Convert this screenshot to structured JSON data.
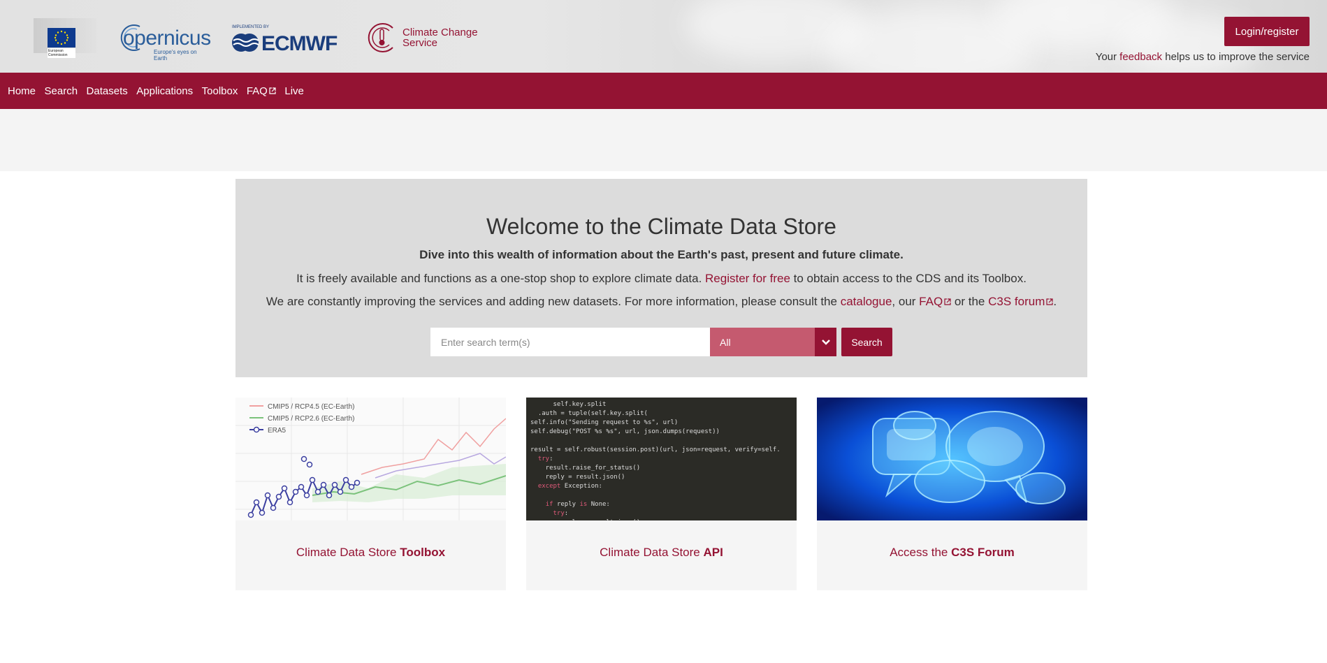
{
  "header": {
    "logos": {
      "ec_text": "European Commission",
      "copernicus_word": "opernicus",
      "copernicus_tagline": "Europe's eyes on Earth",
      "ecmwf_small": "IMPLEMENTED BY",
      "ecmwf_word": "ECMWF",
      "c3s_line1": "Climate Change",
      "c3s_line2": "Service"
    },
    "login_label": "Login/register",
    "feedback_prefix": "Your ",
    "feedback_link": "feedback",
    "feedback_suffix": " helps us to improve the service"
  },
  "nav": {
    "items": [
      {
        "label": "Home",
        "icon": ""
      },
      {
        "label": "Search",
        "icon": ""
      },
      {
        "label": "Datasets",
        "icon": ""
      },
      {
        "label": "Applications",
        "icon": ""
      },
      {
        "label": "Toolbox",
        "icon": ""
      },
      {
        "label": "FAQ",
        "icon": "external-link-icon"
      },
      {
        "label": "Live",
        "icon": ""
      }
    ]
  },
  "hero": {
    "title": "Welcome to the Climate Data Store",
    "lead": "Dive into this wealth of information about the Earth's past, present and future climate.",
    "p1_before": "It is freely available and functions as a one-stop shop to explore climate data. ",
    "p1_link": "Register for free",
    "p1_after": " to obtain access to the CDS and its Toolbox.",
    "p2_before": "We are constantly improving the services and adding new datasets. For more information, please consult the ",
    "p2_link1": "catalogue",
    "p2_mid1": ", our ",
    "p2_link2": "FAQ",
    "p2_mid2": " or the ",
    "p2_link3": "C3S forum",
    "p2_end": "."
  },
  "search": {
    "placeholder": "Enter search term(s)",
    "value": "",
    "select_value": "All",
    "button_label": "Search"
  },
  "cards": [
    {
      "title_prefix": "Climate Data Store ",
      "title_bold": "Toolbox",
      "legend": [
        "CMIP5 / RCP4.5 (EC-Earth)",
        "CMIP5 / RCP2.6 (EC-Earth)",
        "ERA5"
      ]
    },
    {
      "title_prefix": "Climate Data Store ",
      "title_bold": "API"
    },
    {
      "title_prefix": "Access the ",
      "title_bold": "C3S Forum"
    }
  ],
  "colors": {
    "brand": "#941333",
    "brand_light": "#c55a6f",
    "hero_bg": "#dcdcdc"
  }
}
